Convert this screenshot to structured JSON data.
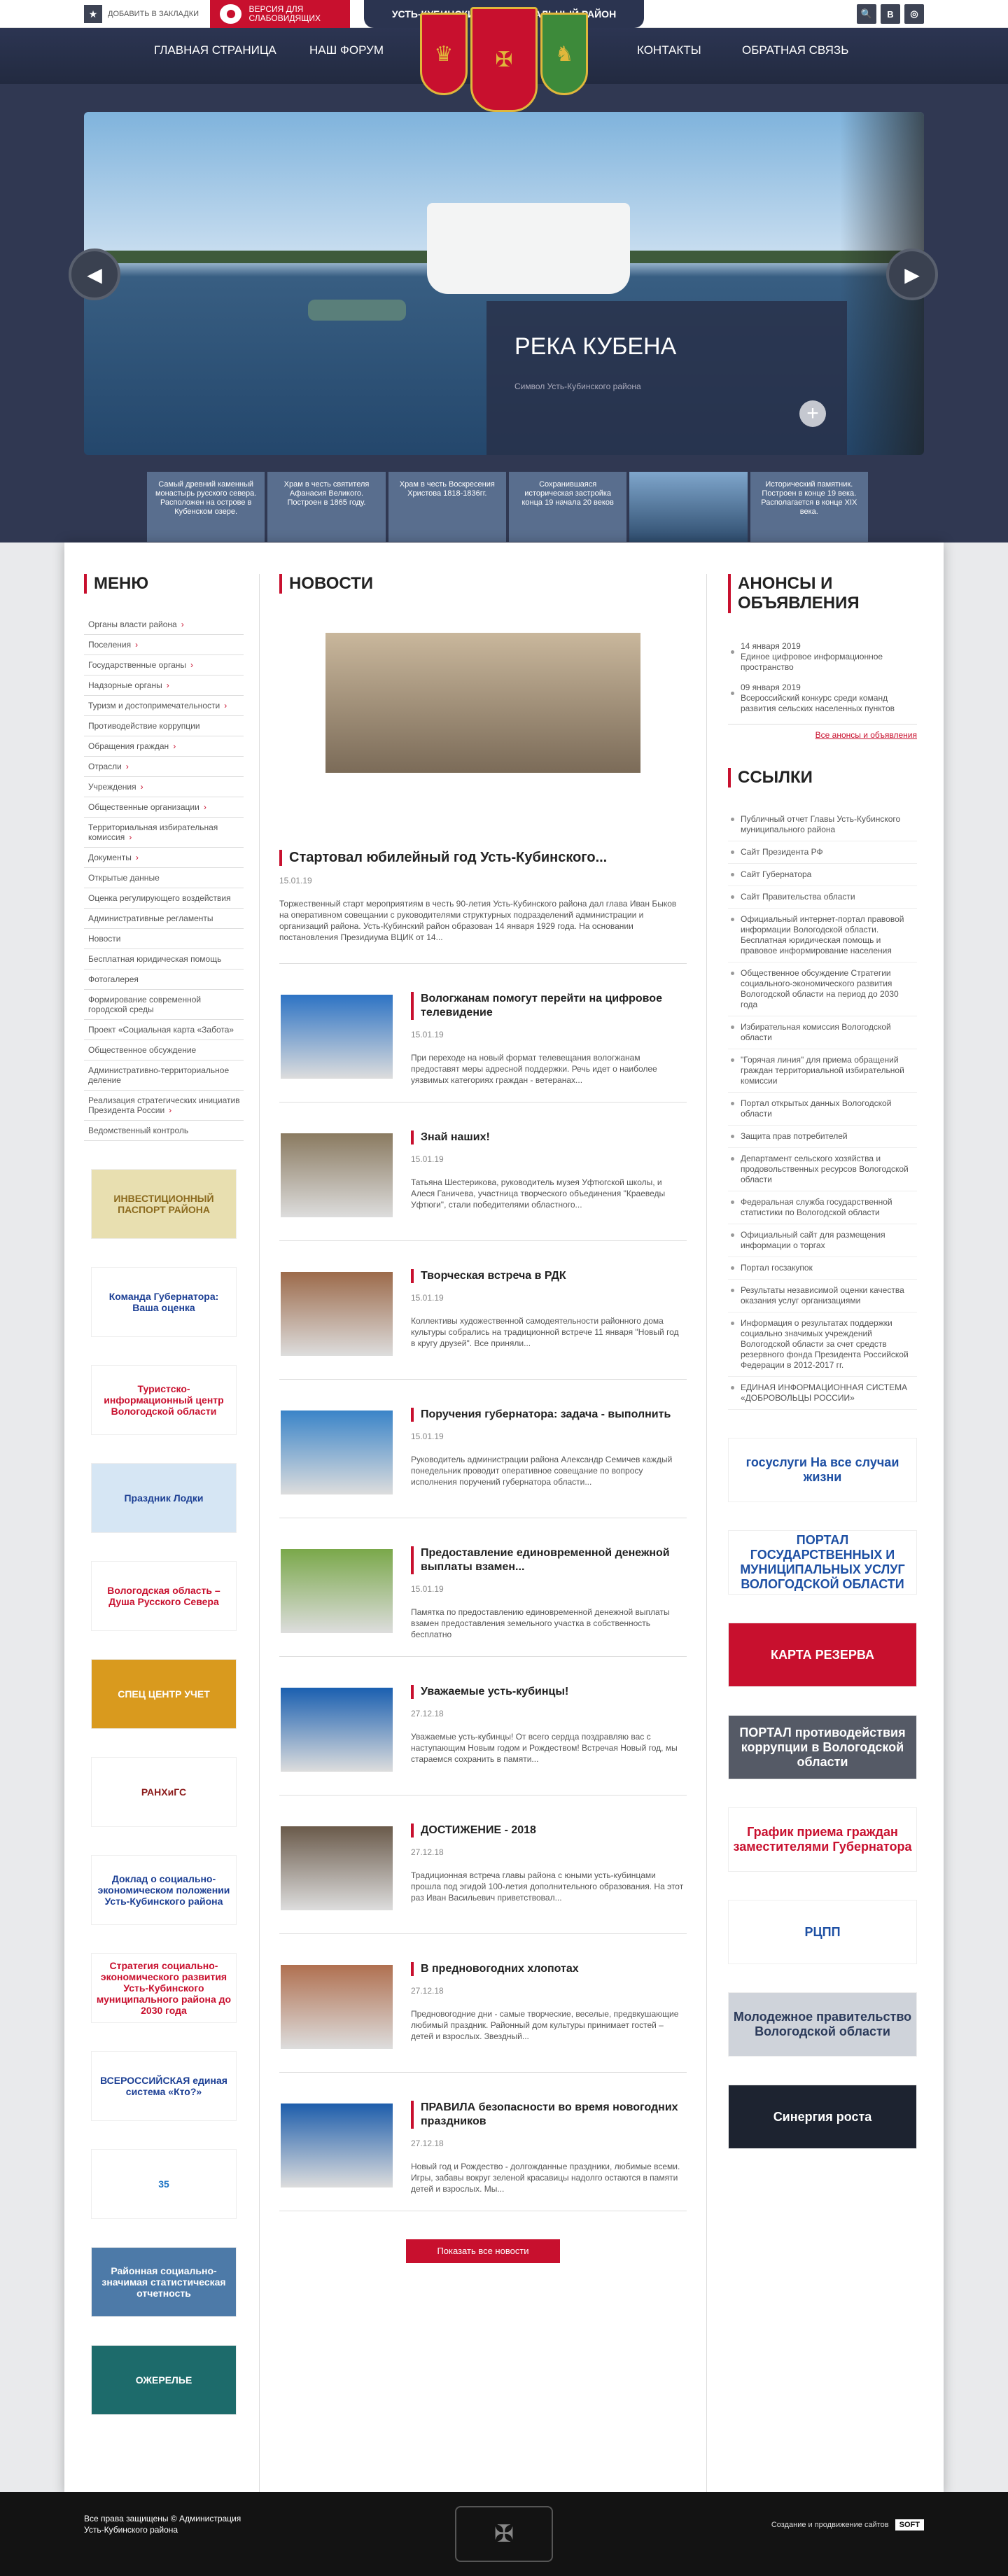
{
  "header": {
    "bookmark_label": "ДОБАВИТЬ В ЗАКЛАДКИ",
    "impaired_label": "ВЕРСИЯ ДЛЯ СЛАБОВИДЯЩИХ",
    "site_title": "УСТЬ-КУБИНСКИЙ МУНИЦИПАЛЬНЫЙ РАЙОН",
    "social": [
      "🔍",
      "В",
      "◎"
    ]
  },
  "nav": [
    "ГЛАВНАЯ СТРАНИЦА",
    "НАШ ФОРУМ",
    "КОНТАКТЫ",
    "ОБРАТНАЯ СВЯЗЬ"
  ],
  "slider": {
    "title": "РЕКА КУБЕНА",
    "subtitle": "Символ Усть-Кубинского района",
    "thumbs": [
      "Самый древний каменный монастырь русского севера. Расположен на острове в Кубенском озере.",
      "Храм в честь святителя Афанасия Великого. Построен в 1865 году.",
      "Храм в честь Воскресения Христова 1818-1836гг.",
      "Сохранившаяся историческая застройка конца 19 начала 20 веков",
      "",
      "Исторический памятник. Построен в конце 19 века. Располагается в конце XIX века."
    ]
  },
  "sidebar": {
    "title": "МЕНЮ",
    "items": [
      {
        "label": "Органы власти района",
        "sub": true
      },
      {
        "label": "Поселения",
        "sub": true
      },
      {
        "label": "Государственные органы",
        "sub": true
      },
      {
        "label": "Надзорные органы",
        "sub": true
      },
      {
        "label": "Туризм и достопримечательности",
        "sub": true
      },
      {
        "label": "Противодействие коррупции",
        "sub": false
      },
      {
        "label": "Обращения граждан",
        "sub": true
      },
      {
        "label": "Отрасли",
        "sub": true
      },
      {
        "label": "Учреждения",
        "sub": true
      },
      {
        "label": "Общественные организации",
        "sub": true
      },
      {
        "label": "Территориальная избирательная комиссия",
        "sub": true
      },
      {
        "label": "Документы",
        "sub": true
      },
      {
        "label": "Открытые данные",
        "sub": false
      },
      {
        "label": "Оценка регулирующего воздействия",
        "sub": false
      },
      {
        "label": "Административные регламенты",
        "sub": false
      },
      {
        "label": "Новости",
        "sub": false
      },
      {
        "label": "Бесплатная юридическая помощь",
        "sub": false
      },
      {
        "label": "Фотогалерея",
        "sub": false
      },
      {
        "label": "Формирование современной городской среды",
        "sub": false
      },
      {
        "label": "Проект «Социальная карта «Забота»",
        "sub": false
      },
      {
        "label": "Общественное обсуждение",
        "sub": false
      },
      {
        "label": "Административно-территориальное деление",
        "sub": false
      },
      {
        "label": "Реализация стратегических инициатив Президента России",
        "sub": true
      },
      {
        "label": "Ведомственный контроль",
        "sub": false
      }
    ],
    "banners": [
      {
        "text": "ИНВЕСТИЦИОННЫЙ ПАСПОРТ РАЙОНА",
        "color": "#8b6a1e",
        "bg": "#e8dfb0"
      },
      {
        "text": "Команда Губернатора: Ваша оценка",
        "color": "#1c3f94",
        "bg": "#ffffff"
      },
      {
        "text": "Туристско-информационный центр Вологодской области",
        "color": "#c8102e",
        "bg": "#ffffff"
      },
      {
        "text": "Праздник Лодки",
        "color": "#1c3f94",
        "bg": "#d6e6f4"
      },
      {
        "text": "Вологодская область – Душа Русского Севера",
        "color": "#c8102e",
        "bg": "#ffffff"
      },
      {
        "text": "СПЕЦ ЦЕНТР УЧЕТ",
        "color": "#ffffff",
        "bg": "#d99a1e"
      },
      {
        "text": "РАНХиГС",
        "color": "#8b1a1a",
        "bg": "#ffffff"
      },
      {
        "text": "Доклад о социально-экономическом положении Усть-Кубинского района",
        "color": "#1c3f94",
        "bg": "#ffffff"
      },
      {
        "text": "Стратегия социально-экономического развития Усть-Кубинского муниципального района до 2030 года",
        "color": "#c8102e",
        "bg": "#ffffff"
      },
      {
        "text": "ВСЕРОССИЙСКАЯ единая система «Кто?»",
        "color": "#1c3f94",
        "bg": "#ffffff"
      },
      {
        "text": "35",
        "color": "#1c73c4",
        "bg": "#ffffff"
      },
      {
        "text": "Районная социально-значимая статистическая отчетность",
        "color": "#ffffff",
        "bg": "#4d7aa8"
      },
      {
        "text": "ОЖЕРЕЛЬЕ",
        "color": "#ffffff",
        "bg": "#1d6b6b"
      }
    ]
  },
  "news": {
    "title": "НОВОСТИ",
    "feature": {
      "title": "Стартовал юбилейный год Усть-Кубинского...",
      "date": "15.01.19",
      "excerpt": "Торжественный старт мероприятиям в честь 90-летия Усть-Кубинского района дал глава Иван Быков на оперативном совещании с руководителями структурных подразделений администрации и организаций района. Усть-Кубинский район образован 14 января 1929 года. На основании постановления Президиума ВЦИК от 14..."
    },
    "items": [
      {
        "title": "Вологжанам помогут перейти на цифровое телевидение",
        "date": "15.01.19",
        "excerpt": "При переходе на новый формат телевещания вологжанам предоставят меры адресной поддержки. Речь идет о наиболее уязвимых категориях граждан - ветеранах...",
        "bg": "#2d73c4"
      },
      {
        "title": "Знай наших!",
        "date": "15.01.19",
        "excerpt": "Татьяна Шестерикова, руководитель музея Уфтюгской школы, и Алеся Ганичева, участница творческого объединения \"Краеведы Уфтюги\", стали победителями областного...",
        "bg": "#8a7a60"
      },
      {
        "title": "Творческая встреча в РДК",
        "date": "15.01.19",
        "excerpt": "Коллективы художественной самодеятельности районного дома культуры собрались на традиционной встрече 11 января \"Новый год в кругу друзей\". Все приняли...",
        "bg": "#9c6a4a"
      },
      {
        "title": "Поручения губернатора: задача - выполнить",
        "date": "15.01.19",
        "excerpt": "Руководитель администрации района Александр Семичев каждый понедельник проводит оперативное совещание по вопросу исполнения поручений губернатора области...",
        "bg": "#3a84c8"
      },
      {
        "title": "Предоставление единовременной денежной выплаты взамен...",
        "date": "15.01.19",
        "excerpt": "Памятка по предоставлению единовременной денежной выплаты взамен предоставления земельного участка в собственность бесплатно",
        "bg": "#7aa84a"
      },
      {
        "title": "Уважаемые усть-кубинцы!",
        "date": "27.12.18",
        "excerpt": "Уважаемые усть-кубинцы! От всего сердца поздравляю вас с наступающим Новым годом и Рождеством! Встречая Новый год, мы стараемся сохранить в памяти...",
        "bg": "#1a5fb0"
      },
      {
        "title": "ДОСТИЖЕНИЕ - 2018",
        "date": "27.12.18",
        "excerpt": "Традиционная встреча главы района с юными усть-кубинцами прошла под эгидой 100-летия дополнительного образования. На этот раз Иван Васильевич приветствовал...",
        "bg": "#6a5a4a"
      },
      {
        "title": "В предновогодних хлопотах",
        "date": "27.12.18",
        "excerpt": "Предновогодние дни - самые творческие, веселые, предвкушающие любимый праздник. Районный дом культуры принимает гостей – детей и взрослых. Звездный...",
        "bg": "#b07050"
      },
      {
        "title": "ПРАВИЛА безопасности во время новогодних праздников",
        "date": "27.12.18",
        "excerpt": "Новый год и Рождество - долгожданные праздники, любимые всеми. Игры, забавы вокруг зеленой красавицы надолго остаются в памяти детей и взрослых. Мы...",
        "bg": "#1d5dab"
      }
    ],
    "show_all": "Показать все новости"
  },
  "announcements": {
    "title": "АНОНСЫ И ОБЪЯВЛЕНИЯ",
    "items": [
      {
        "date": "14 января 2019",
        "text": "Единое цифровое информационное пространство"
      },
      {
        "date": "09 января 2019",
        "text": "Всероссийский конкурс среди команд развития сельских населенных пунктов"
      }
    ],
    "all_link": "Все анонсы и объявления"
  },
  "links": {
    "title": "ССЫЛКИ",
    "items": [
      "Публичный отчет Главы Усть-Кубинского муниципального района",
      "Сайт Президента РФ",
      "Сайт Губернатора",
      "Сайт Правительства области",
      "Официальный интернет-портал правовой информации Вологодской области. Бесплатная юридическая помощь и правовое информирование населения",
      "Общественное обсуждение Стратегии социального-экономического развития Вологодской области на период до 2030 года",
      "Избирательная комиссия Вологодской области",
      "\"Горячая линия\" для приема обращений граждан территориальной избирательной комиссии",
      "Портал открытых данных Вологодской области",
      "Защита прав потребителей",
      "Департамент сельского хозяйства и продовольственных ресурсов Вологодской области",
      "Федеральная служба государственной статистики по Вологодской области",
      "Официальный сайт для размещения информации о торгах",
      "Портал госзакупок",
      "Результаты независимой оценки качества оказания услуг организациями",
      "Информация о результатах поддержки социально значимых учреждений Вологодской области за счет средств резервного фонда Президента Российской Федерации в 2012-2017 гг.",
      "ЕДИНАЯ ИНФОРМАЦИОННАЯ СИСТЕМА «ДОБРОВОЛЬЦЫ РОССИИ»"
    ],
    "banners": [
      {
        "text": "госуслуги На все случаи жизни",
        "color": "#1d4fa3",
        "bg": "#ffffff"
      },
      {
        "text": "ПОРТАЛ ГОСУДАРСТВЕННЫХ И МУНИЦИПАЛЬНЫХ УСЛУГ ВОЛОГОДСКОЙ ОБЛАСТИ",
        "color": "#1d4fa3",
        "bg": "#ffffff"
      },
      {
        "text": "КАРТА РЕЗЕРВА",
        "color": "#ffffff",
        "bg": "#c8102e"
      },
      {
        "text": "ПОРТАЛ противодействия коррупции в Вологодской области",
        "color": "#ffffff",
        "bg": "#555a66"
      },
      {
        "text": "График приема граждан заместителями Губернатора",
        "color": "#c8102e",
        "bg": "#ffffff"
      },
      {
        "text": "РЦПП",
        "color": "#1d4fa3",
        "bg": "#ffffff"
      },
      {
        "text": "Молодежное правительство Вологодской области",
        "color": "#2b3a5a",
        "bg": "#cfd3da"
      },
      {
        "text": "Синергия роста",
        "color": "#ffffff",
        "bg": "#1d2330"
      }
    ]
  },
  "footer": {
    "copyright": "Все права защищены © Администрация Усть-Кубинского района",
    "dev": "Создание и продвижение сайтов",
    "dev_brand": "SOFT"
  }
}
